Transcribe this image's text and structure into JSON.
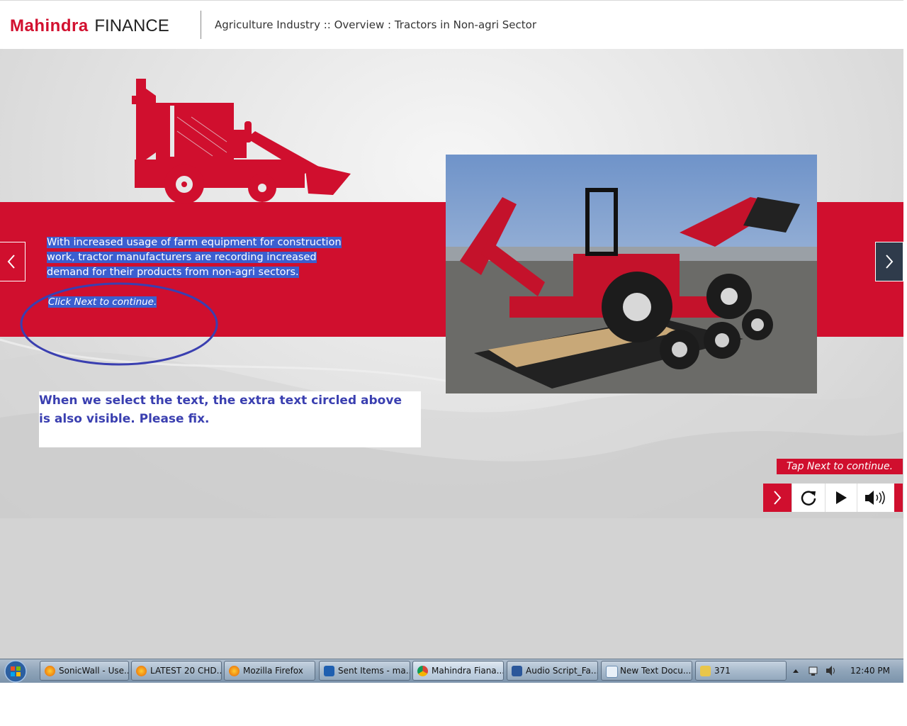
{
  "header": {
    "logo_brand": "Mahindra",
    "logo_suffix": "FINANCE",
    "breadcrumb": "Agriculture Industry :: Overview : Tractors in Non-agri Sector"
  },
  "slide": {
    "body_text": "With increased usage of farm equipment for construction work, tractor manufacturers are recording increased demand for their products from non-agri sectors.",
    "continue_text": "Click Next to continue.",
    "annotation_note": "When we select the text, the extra text circled above is also visible. Please fix.",
    "tap_label": "Tap Next to continue.",
    "colors": {
      "accent_red": "#d00f2e",
      "selection_blue": "#3b5fd0",
      "annotation_blue": "#3a3fb0"
    }
  },
  "nav": {
    "prev_icon": "chevron-left-icon",
    "next_icon": "chevron-right-icon"
  },
  "controls": {
    "next_icon": "chevron-right-icon",
    "replay_icon": "replay-icon",
    "play_icon": "play-icon",
    "audio_icon": "speaker-icon"
  },
  "taskbar": {
    "items": [
      {
        "label": "SonicWall - Use...",
        "icon": "firefox-icon"
      },
      {
        "label": "LATEST 20 CHD...",
        "icon": "firefox-icon"
      },
      {
        "label": "Mozilla Firefox",
        "icon": "firefox-icon"
      },
      {
        "label": "Sent Items - ma...",
        "icon": "outlook-icon"
      },
      {
        "label": "Mahindra Fiana...",
        "icon": "chrome-icon"
      },
      {
        "label": "Audio Script_Fa...",
        "icon": "word-icon"
      },
      {
        "label": "New Text Docu...",
        "icon": "notepad-icon"
      },
      {
        "label": "371",
        "icon": "folder-icon"
      }
    ],
    "clock": "12:40 PM"
  }
}
